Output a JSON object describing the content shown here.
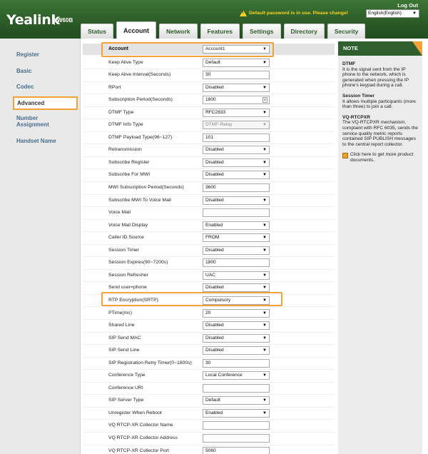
{
  "header": {
    "brand": "Yealink",
    "model": "W60B",
    "logout": "Log Out",
    "warning": "Default password is in use. Please change!",
    "language": "English(English)"
  },
  "tabs": [
    {
      "label": "Status",
      "active": false
    },
    {
      "label": "Account",
      "active": true
    },
    {
      "label": "Network",
      "active": false
    },
    {
      "label": "Features",
      "active": false
    },
    {
      "label": "Settings",
      "active": false
    },
    {
      "label": "Directory",
      "active": false
    },
    {
      "label": "Security",
      "active": false
    }
  ],
  "sidebar": {
    "items": [
      {
        "label": "Register"
      },
      {
        "label": "Basic"
      },
      {
        "label": "Codec"
      },
      {
        "label": "Advanced",
        "active": true
      },
      {
        "label": "Number Assignment"
      },
      {
        "label": "Handset Name"
      }
    ]
  },
  "form": {
    "account_label": "Account",
    "account_value": "Account1",
    "rows": [
      {
        "label": "Keep Alive Type",
        "value": "Default",
        "type": "select"
      },
      {
        "label": "Keep Alive Interval(Seconds)",
        "value": "30",
        "type": "input"
      },
      {
        "label": "RPort",
        "value": "Disabled",
        "type": "select"
      },
      {
        "label": "Subscription Period(Seconds)",
        "value": "1800",
        "type": "spin"
      },
      {
        "label": "DTMF Type",
        "value": "RFC2833",
        "type": "select"
      },
      {
        "label": "DTMF Info Type",
        "value": "DTMF-Relay",
        "type": "select-disabled"
      },
      {
        "label": "DTMF Payload Type(96~127)",
        "value": "101",
        "type": "input"
      },
      {
        "label": "Retransmission",
        "value": "Disabled",
        "type": "select"
      },
      {
        "label": "Subscribe Register",
        "value": "Disabled",
        "type": "select"
      },
      {
        "label": "Subscribe For MWI",
        "value": "Disabled",
        "type": "select"
      },
      {
        "label": "MWI Subscription Period(Seconds)",
        "value": "3600",
        "type": "input"
      },
      {
        "label": "Subscribe MWI To Voice Mail",
        "value": "Disabled",
        "type": "select"
      },
      {
        "label": "Voice Mail",
        "value": "",
        "type": "input"
      },
      {
        "label": "Voice Mail Display",
        "value": "Enabled",
        "type": "select"
      },
      {
        "label": "Caller ID Source",
        "value": "FROM",
        "type": "select"
      },
      {
        "label": "Session Timer",
        "value": "Disabled",
        "type": "select"
      },
      {
        "label": "Session Expires(90~7200s)",
        "value": "1800",
        "type": "input"
      },
      {
        "label": "Session Refresher",
        "value": "UAC",
        "type": "select"
      },
      {
        "label": "Send user=phone",
        "value": "Disabled",
        "type": "select"
      },
      {
        "label": "RTP Encryption(SRTP)",
        "value": "Compulsory",
        "type": "select"
      },
      {
        "label": "PTime(ms)",
        "value": "20",
        "type": "select"
      },
      {
        "label": "Shared Line",
        "value": "Disabled",
        "type": "select"
      },
      {
        "label": "SIP Send MAC",
        "value": "Disabled",
        "type": "select"
      },
      {
        "label": "SIP Send Line",
        "value": "Disabled",
        "type": "select"
      },
      {
        "label": "SIP Registration Retry Timer(0~1800s)",
        "value": "30",
        "type": "input"
      },
      {
        "label": "Conference Type",
        "value": "Local Conference",
        "type": "select"
      },
      {
        "label": "Conference URI",
        "value": "",
        "type": "input"
      },
      {
        "label": "SIP Server Type",
        "value": "Default",
        "type": "select"
      },
      {
        "label": "Unregister When Reboot",
        "value": "Enabled",
        "type": "select"
      },
      {
        "label": "VQ RTCP-XR Collector Name",
        "value": "",
        "type": "input"
      },
      {
        "label": "VQ RTCP-XR Collector Address",
        "value": "",
        "type": "input"
      },
      {
        "label": "VQ RTCP-XR Collector Port",
        "value": "5060",
        "type": "input"
      }
    ]
  },
  "note": {
    "title": "NOTE",
    "sections": [
      {
        "heading": "DTMF",
        "text": "It is the signal sent from the IP phone to the network, which is generated when pressing the IP phone's keypad during a call."
      },
      {
        "heading": "Session Timer",
        "text": "It allows multiple participants (more than three) to join a call."
      },
      {
        "heading": "VQ-RTCPXR",
        "text": "The VQ-RTCPXR mechanism, complaint with RFC 6035, sends the service quality metric reports contained SIP PUBLISH messages to the central report collector."
      }
    ],
    "link": "Click here to get more product documents."
  },
  "colors": {
    "header_green": "#2e5f2a",
    "highlight_orange": "#f3a23a",
    "sidebar_link": "#476d8e"
  }
}
